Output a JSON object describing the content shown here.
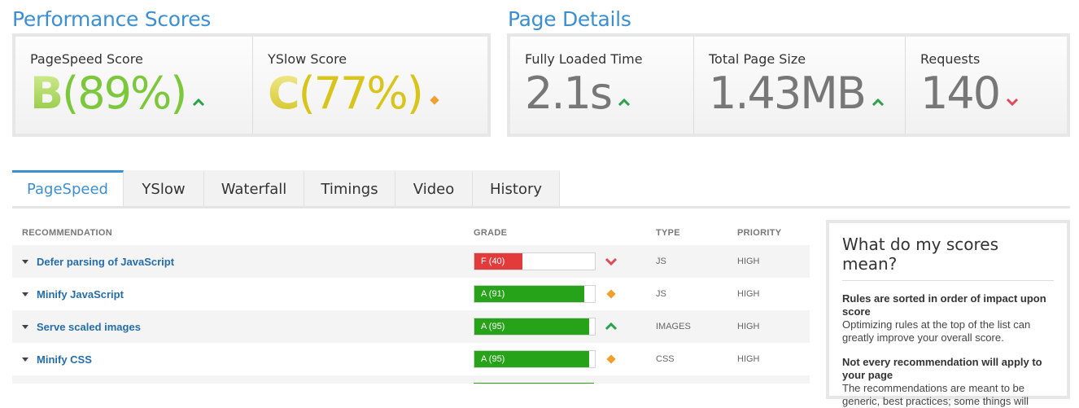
{
  "performance": {
    "title": "Performance Scores",
    "pagespeed": {
      "label": "PageSpeed Score",
      "grade": "B",
      "percent": "(89%)",
      "color": "#7dc73c",
      "trend": "up"
    },
    "yslow": {
      "label": "YSlow Score",
      "grade": "C",
      "percent": "(77%)",
      "color": "#d8c41a",
      "trend": "neutral"
    }
  },
  "details": {
    "title": "Page Details",
    "loaded": {
      "label": "Fully Loaded Time",
      "value": "2.1s",
      "trend": "up"
    },
    "size": {
      "label": "Total Page Size",
      "value": "1.43MB",
      "trend": "up"
    },
    "requests": {
      "label": "Requests",
      "value": "140",
      "trend": "down"
    }
  },
  "tabs": [
    "PageSpeed",
    "YSlow",
    "Waterfall",
    "Timings",
    "Video",
    "History"
  ],
  "active_tab": "PageSpeed",
  "table": {
    "headers": {
      "recommendation": "RECOMMENDATION",
      "grade": "GRADE",
      "type": "TYPE",
      "priority": "PRIORITY"
    },
    "rows": [
      {
        "name": "Defer parsing of JavaScript",
        "grade": "F (40)",
        "score": 40,
        "color": "#e33b3b",
        "trend": "down",
        "type": "JS",
        "priority": "HIGH"
      },
      {
        "name": "Minify JavaScript",
        "grade": "A (91)",
        "score": 91,
        "color": "#27a31a",
        "trend": "neutral",
        "type": "JS",
        "priority": "HIGH"
      },
      {
        "name": "Serve scaled images",
        "grade": "A (95)",
        "score": 95,
        "color": "#27a31a",
        "trend": "up",
        "type": "IMAGES",
        "priority": "HIGH"
      },
      {
        "name": "Minify CSS",
        "grade": "A (95)",
        "score": 95,
        "color": "#27a31a",
        "trend": "neutral",
        "type": "CSS",
        "priority": "HIGH"
      }
    ]
  },
  "sidebar": {
    "title": "What do my scores mean?",
    "h1": "Rules are sorted in order of impact upon score",
    "p1": "Optimizing rules at the top of the list can greatly improve your overall score.",
    "h2": "Not every recommendation will apply to your page",
    "p2": "The recommendations are meant to be generic, best practices; some things will"
  },
  "colors": {
    "accent": "#3d8fd0",
    "up": "#2aa34a",
    "down": "#e04a5a",
    "neutral": "#f0a030"
  }
}
